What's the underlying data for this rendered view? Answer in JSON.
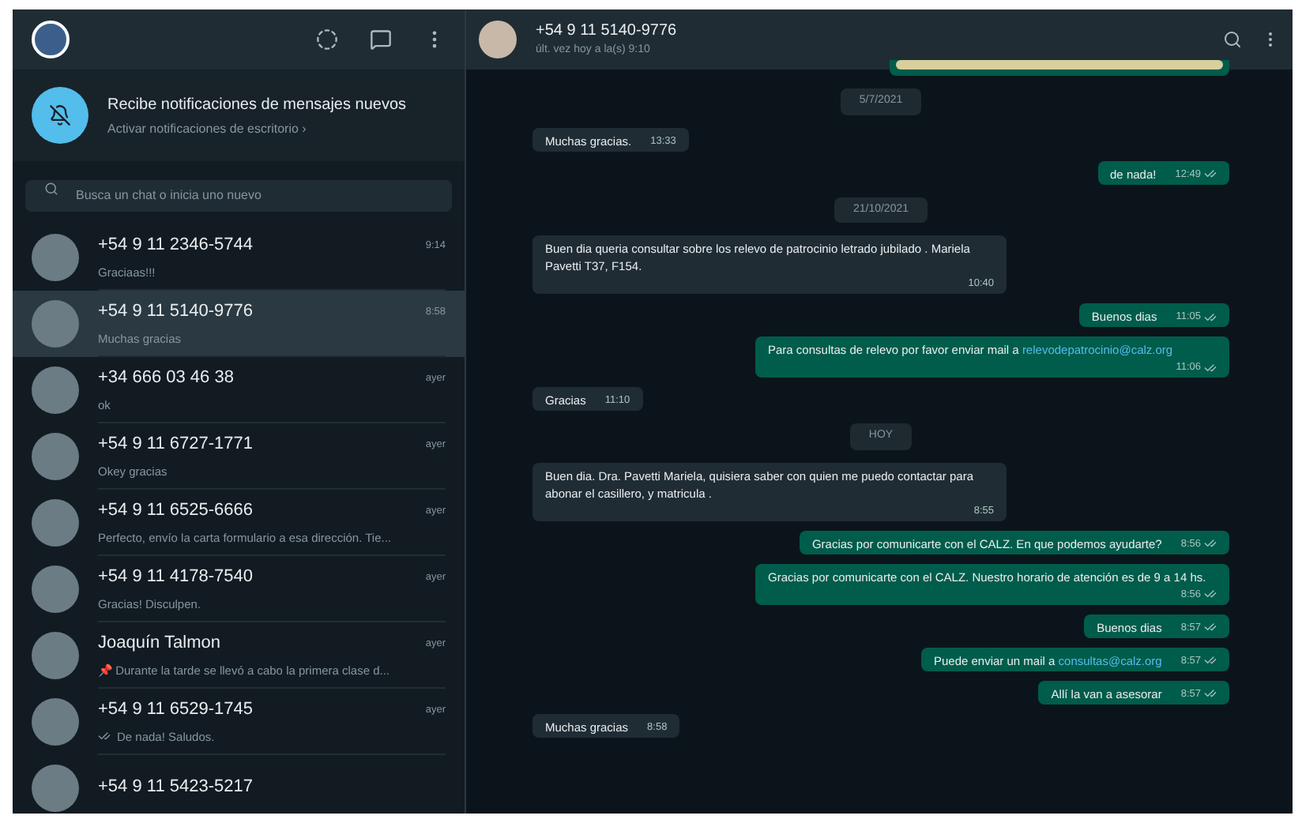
{
  "sidebar": {
    "notification": {
      "title": "Recibe notificaciones de mensajes nuevos",
      "link": "Activar notificaciones de escritorio ›"
    },
    "search": {
      "placeholder": "Busca un chat o inicia uno nuevo"
    },
    "chats": [
      {
        "name": "+54 9 11 2346-5744",
        "preview": "Graciaas!!!",
        "time": "9:14",
        "selected": false,
        "read_ticks": false
      },
      {
        "name": "+54 9 11 5140-9776",
        "preview": "Muchas gracias",
        "time": "8:58",
        "selected": true,
        "read_ticks": false
      },
      {
        "name": "+34 666 03 46 38",
        "preview": "ok",
        "time": "ayer",
        "selected": false,
        "read_ticks": false
      },
      {
        "name": "+54 9 11 6727-1771",
        "preview": "Okey gracias",
        "time": "ayer",
        "selected": false,
        "read_ticks": false
      },
      {
        "name": "+54 9 11 6525-6666",
        "preview": "Perfecto, envío la carta formulario a esa dirección. Tie...",
        "time": "ayer",
        "selected": false,
        "read_ticks": false
      },
      {
        "name": "+54 9 11 4178-7540",
        "preview": "Gracias! Disculpen.",
        "time": "ayer",
        "selected": false,
        "read_ticks": false
      },
      {
        "name": "Joaquín Talmon",
        "preview": "📌 Durante la tarde se llevó a cabo la primera clase d...",
        "time": "ayer",
        "selected": false,
        "read_ticks": false
      },
      {
        "name": "+54 9 11 6529-1745",
        "preview": "De nada! Saludos.",
        "time": "ayer",
        "selected": false,
        "read_ticks": true
      },
      {
        "name": "+54 9 11 5423-5217",
        "selected": false
      }
    ]
  },
  "conversation": {
    "contact": "+54 9 11 5140-9776",
    "last_seen": "últ. vez hoy a la(s) 9:10",
    "messages": [
      {
        "kind": "image_out"
      },
      {
        "kind": "date",
        "text": "5/7/2021"
      },
      {
        "kind": "in",
        "text": "Muchas gracias.",
        "time": "13:33"
      },
      {
        "kind": "out",
        "text": "de nada!",
        "time": "12:49"
      },
      {
        "kind": "date",
        "text": "21/10/2021"
      },
      {
        "kind": "in",
        "text": "Buen dia queria consultar sobre los relevo de patrocinio letrado   jubilado . Mariela Pavetti T37, F154.",
        "time": "10:40"
      },
      {
        "kind": "out",
        "text": "Buenos dias",
        "time": "11:05"
      },
      {
        "kind": "out",
        "text": "Para consultas de relevo por favor enviar mail a",
        "link": "relevodepatrocinio@calz.org",
        "time": "11:06"
      },
      {
        "kind": "in",
        "text": "Gracias",
        "time": "11:10"
      },
      {
        "kind": "date",
        "text": "HOY"
      },
      {
        "kind": "in",
        "text": "Buen dia.  Dra. Pavetti Mariela, quisiera saber con quien me puedo contactar para abonar el casillero, y matricula .",
        "time": "8:55"
      },
      {
        "kind": "out",
        "text": "Gracias por comunicarte con el CALZ. En que podemos ayudarte?",
        "time": "8:56"
      },
      {
        "kind": "out",
        "text": "Gracias por comunicarte con el CALZ. Nuestro horario de atención es de 9 a 14 hs.",
        "time": "8:56"
      },
      {
        "kind": "out",
        "text": "Buenos dias",
        "time": "8:57"
      },
      {
        "kind": "out",
        "text": "Puede enviar un mail a",
        "link": "consultas@calz.org",
        "time": "8:57"
      },
      {
        "kind": "out",
        "text": "Allí la van a asesorar",
        "time": "8:57"
      },
      {
        "kind": "in",
        "text": "Muchas gracias",
        "time": "8:58"
      }
    ]
  }
}
